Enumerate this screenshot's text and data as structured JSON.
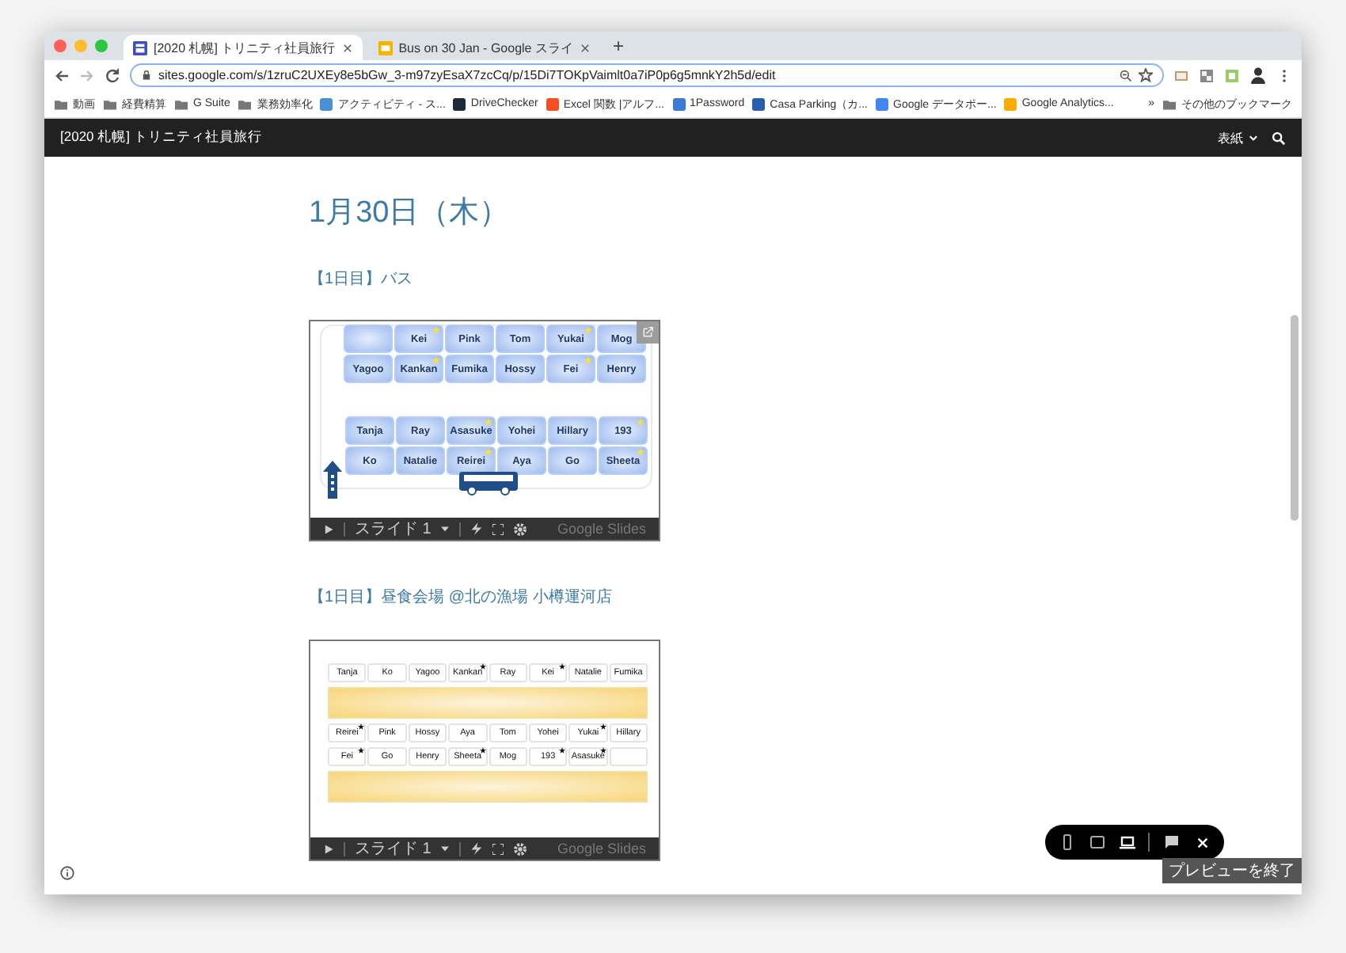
{
  "browser": {
    "tabs": [
      {
        "title": "[2020 札幌] トリニティ社員旅行",
        "kind": "sites",
        "selected": true
      },
      {
        "title": "Bus on 30 Jan - Google スライ",
        "kind": "slides",
        "selected": false
      }
    ],
    "new_tab": "+",
    "url": "sites.google.com/s/1zruC2UXEy8e5bGw_3-m97zyEsaX7zcCq/p/15Di7TOKpVaimlt0a7iP0p6g5mnkY2h5d/edit",
    "bookmarks": [
      {
        "label": "動画",
        "kind": "folder"
      },
      {
        "label": "経費精算",
        "kind": "folder"
      },
      {
        "label": "G Suite",
        "kind": "folder"
      },
      {
        "label": "業務効率化",
        "kind": "folder"
      },
      {
        "label": "アクティビティ - ス...",
        "kind": "app",
        "color": "#4a8fd8"
      },
      {
        "label": "DriveChecker",
        "kind": "app",
        "color": "#1d2b3a"
      },
      {
        "label": "Excel 関数 |アルフ...",
        "kind": "app",
        "color": "#f25022"
      },
      {
        "label": "1Password",
        "kind": "app",
        "color": "#3b7bd4"
      },
      {
        "label": "Casa Parking（カ...",
        "kind": "app",
        "color": "#2a5db0"
      },
      {
        "label": "Google データポー...",
        "kind": "app",
        "color": "#4285f4"
      },
      {
        "label": "Google Analytics...",
        "kind": "app",
        "color": "#f9ab00"
      }
    ],
    "more": "»",
    "other_bookmarks": "その他のブックマーク"
  },
  "site": {
    "title": "[2020 札幌] トリニティ社員旅行",
    "nav": "表紙"
  },
  "page_title": "1月30日（木）",
  "slides": [
    {
      "kind": "seating",
      "title": "【1日目】バス",
      "seat_blocks": [
        [
          [
            {
              "kind": "empty"
            },
            {
              "kind": "seat",
              "name": "Kei",
              "starred": true
            },
            {
              "kind": "seat",
              "name": "Pink",
              "starred": false
            },
            {
              "kind": "seat",
              "name": "Tom",
              "starred": false
            },
            {
              "kind": "seat",
              "name": "Yukai",
              "starred": true
            },
            {
              "kind": "seat",
              "name": "Mog",
              "starred": false
            }
          ],
          [
            {
              "kind": "seat",
              "name": "Yagoo",
              "starred": false
            },
            {
              "kind": "seat",
              "name": "Kankan",
              "starred": true
            },
            {
              "kind": "seat",
              "name": "Fumika",
              "starred": false
            },
            {
              "kind": "seat",
              "name": "Hossy",
              "starred": false
            },
            {
              "kind": "seat",
              "name": "Fei",
              "starred": true
            },
            {
              "kind": "seat",
              "name": "Henry",
              "starred": false
            }
          ]
        ],
        [
          [
            {
              "kind": "seat",
              "name": "Tanja",
              "starred": false
            },
            {
              "kind": "seat",
              "name": "Ray",
              "starred": false
            },
            {
              "kind": "seat",
              "name": "Asasuke",
              "starred": true
            },
            {
              "kind": "seat",
              "name": "Yohei",
              "starred": false
            },
            {
              "kind": "seat",
              "name": "Hillary",
              "starred": false
            },
            {
              "kind": "seat",
              "name": "193",
              "starred": true
            }
          ],
          [
            {
              "kind": "seat",
              "name": "Ko",
              "starred": false
            },
            {
              "kind": "seat",
              "name": "Natalie",
              "starred": false
            },
            {
              "kind": "seat",
              "name": "Reirei",
              "starred": true
            },
            {
              "kind": "seat",
              "name": "Aya",
              "starred": false
            },
            {
              "kind": "seat",
              "name": "Go",
              "starred": false
            },
            {
              "kind": "seat",
              "name": "Sheeta",
              "starred": true
            }
          ]
        ]
      ],
      "toolbar": {
        "slide_label": "スライド 1",
        "brand": "Google Slides"
      }
    },
    {
      "kind": "tables",
      "title": "【1日目】昼食会場 @北の漁場 小樽運河店",
      "rows": [
        {
          "kind": "seats",
          "seats": [
            {
              "kind": "seat",
              "name": "Tanja",
              "starred": false
            },
            {
              "kind": "seat",
              "name": "Ko",
              "starred": false
            },
            {
              "kind": "seat",
              "name": "Yagoo",
              "starred": false
            },
            {
              "kind": "seat",
              "name": "Kankan",
              "starred": true
            },
            {
              "kind": "seat",
              "name": "Ray",
              "starred": false
            },
            {
              "kind": "seat",
              "name": "Kei",
              "starred": true
            },
            {
              "kind": "seat",
              "name": "Natalie",
              "starred": false
            },
            {
              "kind": "seat",
              "name": "Fumika",
              "starred": false
            }
          ]
        },
        {
          "kind": "table"
        },
        {
          "kind": "seats",
          "seats": [
            {
              "kind": "seat",
              "name": "Reirei",
              "starred": true
            },
            {
              "kind": "seat",
              "name": "Pink",
              "starred": false
            },
            {
              "kind": "seat",
              "name": "Hossy",
              "starred": false
            },
            {
              "kind": "seat",
              "name": "Aya",
              "starred": false
            },
            {
              "kind": "seat",
              "name": "Tom",
              "starred": false
            },
            {
              "kind": "seat",
              "name": "Yohei",
              "starred": false
            },
            {
              "kind": "seat",
              "name": "Yukai",
              "starred": true
            },
            {
              "kind": "seat",
              "name": "Hillary",
              "starred": false
            }
          ]
        },
        {
          "kind": "seats",
          "seats": [
            {
              "kind": "seat",
              "name": "Fei",
              "starred": true
            },
            {
              "kind": "seat",
              "name": "Go",
              "starred": false
            },
            {
              "kind": "seat",
              "name": "Henry",
              "starred": false
            },
            {
              "kind": "seat",
              "name": "Sheeta",
              "starred": true
            },
            {
              "kind": "seat",
              "name": "Mog",
              "starred": false
            },
            {
              "kind": "seat",
              "name": "193",
              "starred": true
            },
            {
              "kind": "seat",
              "name": "Asasuke",
              "starred": true
            },
            {
              "kind": "empty"
            }
          ]
        },
        {
          "kind": "table"
        }
      ],
      "toolbar": {
        "slide_label": "スライド 1",
        "brand": "Google Slides"
      }
    }
  ],
  "preview_bar": {
    "devices": [
      {
        "kind": "phone",
        "selected": false
      },
      {
        "kind": "tablet",
        "selected": false
      },
      {
        "kind": "laptop",
        "selected": true
      }
    ],
    "actions": [
      {
        "kind": "feedback"
      },
      {
        "kind": "close"
      }
    ],
    "tooltip": "プレビューを終了"
  }
}
